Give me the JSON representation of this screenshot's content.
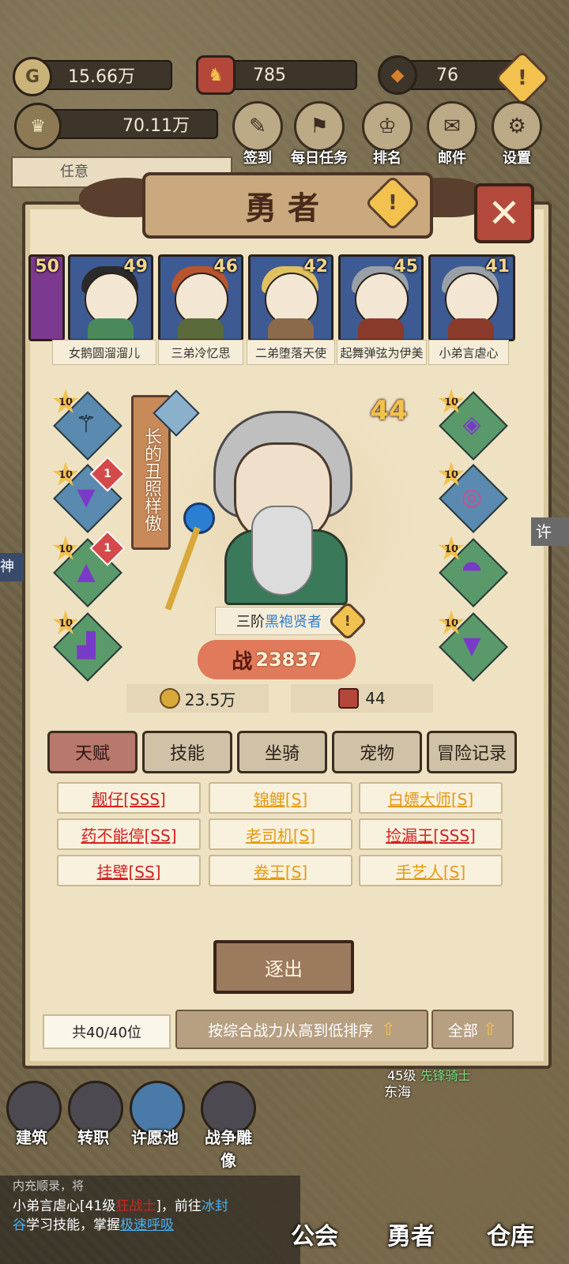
{
  "resources": {
    "gold": "15.66万",
    "shield_value": "785",
    "gem_value": "76",
    "power_total": "70.11万"
  },
  "top_menu": [
    {
      "label": "签到",
      "icon": "scroll-icon"
    },
    {
      "label": "每日任务",
      "icon": "quest-icon"
    },
    {
      "label": "排名",
      "icon": "crown-icon"
    },
    {
      "label": "邮件",
      "icon": "mail-icon"
    },
    {
      "label": "设置",
      "icon": "gear-icon"
    }
  ],
  "task_hint": "任意",
  "panel_title": "勇者",
  "heroes": [
    {
      "level": "50",
      "name": ""
    },
    {
      "level": "49",
      "name": "女鹅圆溜溜儿"
    },
    {
      "level": "46",
      "name": "三弟冷忆思"
    },
    {
      "level": "42",
      "name": "二弟堕落天使"
    },
    {
      "level": "45",
      "name": "起舞弹弦为伊美"
    },
    {
      "level": "41",
      "name": "小弟言虐心"
    }
  ],
  "selected_hero": {
    "nickname": "长的丑照样傲",
    "level": "44",
    "rank": "三阶",
    "class_name": "黑袍贤者",
    "power_prefix": "战",
    "power": "23837",
    "gold_cost": "23.5万",
    "stat_value": "44"
  },
  "equipment_left": [
    {
      "stars": "10",
      "badge": "",
      "icon": "staff-icon"
    },
    {
      "stars": "10",
      "badge": "1",
      "icon": "robe-icon"
    },
    {
      "stars": "10",
      "badge": "1",
      "icon": "helmet-icon"
    },
    {
      "stars": "10",
      "badge": "",
      "icon": "boots-icon"
    }
  ],
  "equipment_right": [
    {
      "stars": "10",
      "icon": "necklace-icon"
    },
    {
      "stars": "10",
      "icon": "ring-icon"
    },
    {
      "stars": "10",
      "icon": "shoulder-icon"
    },
    {
      "stars": "10",
      "icon": "cape-icon"
    }
  ],
  "tabs": [
    "天赋",
    "技能",
    "坐骑",
    "宠物",
    "冒险记录"
  ],
  "traits": [
    {
      "label": "靓仔[SSS]",
      "grade": "sss"
    },
    {
      "label": "锦鲤[S]",
      "grade": "s"
    },
    {
      "label": "白嫖大师[S]",
      "grade": "s"
    },
    {
      "label": "药不能停[SS]",
      "grade": "sss"
    },
    {
      "label": "老司机[S]",
      "grade": "s"
    },
    {
      "label": "捡漏王[SSS]",
      "grade": "sss"
    },
    {
      "label": "挂壁[SS]",
      "grade": "sss"
    },
    {
      "label": "卷王[S]",
      "grade": "s"
    },
    {
      "label": "手艺人[S]",
      "grade": "s"
    }
  ],
  "dismiss_button": "逐出",
  "footer": {
    "count": "共40/40位",
    "sort_label": "按综合战力从高到低排序",
    "filter_label": "全部"
  },
  "bottom_left_menu": [
    "建筑",
    "转职",
    "许愿池",
    "战争雕像"
  ],
  "map_label": {
    "level_text": "45级",
    "class_text": "先锋骑士",
    "place": "东海"
  },
  "chat": {
    "line1": "内充顺录，将",
    "line2a": "小弟言虐心[41级",
    "line2b": "狂战士",
    "line2c": "]，前往",
    "line2d": "冰封",
    "line3a": "谷",
    "line3b": "学习技能，掌握",
    "line3c": "极速呼吸"
  },
  "bottom_nav": [
    "公会",
    "勇者",
    "仓库"
  ],
  "side_hint": "许",
  "side_hint_left": "神殿"
}
